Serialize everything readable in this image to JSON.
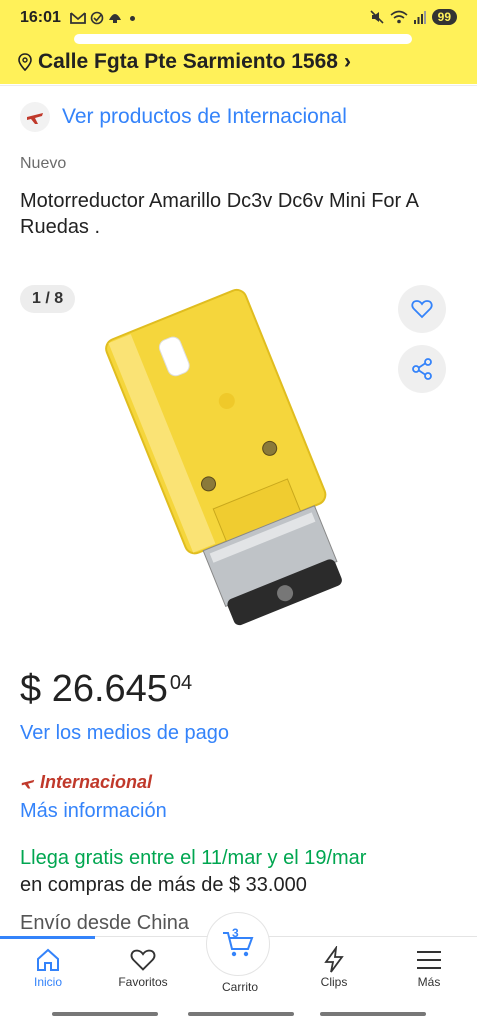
{
  "status_bar": {
    "time": "16:01",
    "battery": "99"
  },
  "header": {
    "address": "Calle Fgta Pte Sarmiento 1568",
    "address_chevron": "›"
  },
  "international_link": {
    "label": "Ver productos de Internacional",
    "icon": "airplane-icon"
  },
  "product": {
    "condition": "Nuevo",
    "title": "Motorreductor Amarillo Dc3v Dc6v Mini For A Ruedas .",
    "image_counter": "1 / 8",
    "price_main": "$ 26.645",
    "price_cents": "04",
    "payment_link": "Ver los medios de pago",
    "intl_badge": "Internacional",
    "more_info": "Más información",
    "shipping": "Llega gratis entre el 11/mar y el 19/mar",
    "shipping_condition": "en compras de más de $ 33.000",
    "ship_from": "Envío desde China"
  },
  "colors": {
    "brand_yellow": "#fff159",
    "link_blue": "#3483fa",
    "free_green": "#00a650",
    "intl_red": "#c0392b"
  },
  "bottom_nav": {
    "items": [
      {
        "label": "Inicio",
        "icon": "home-icon",
        "active": true
      },
      {
        "label": "Favoritos",
        "icon": "heart-icon",
        "active": false
      },
      {
        "label": "Carrito",
        "icon": "cart-icon",
        "active": false,
        "badge": "3"
      },
      {
        "label": "Clips",
        "icon": "lightning-icon",
        "active": false
      },
      {
        "label": "Más",
        "icon": "menu-icon",
        "active": false
      }
    ]
  }
}
